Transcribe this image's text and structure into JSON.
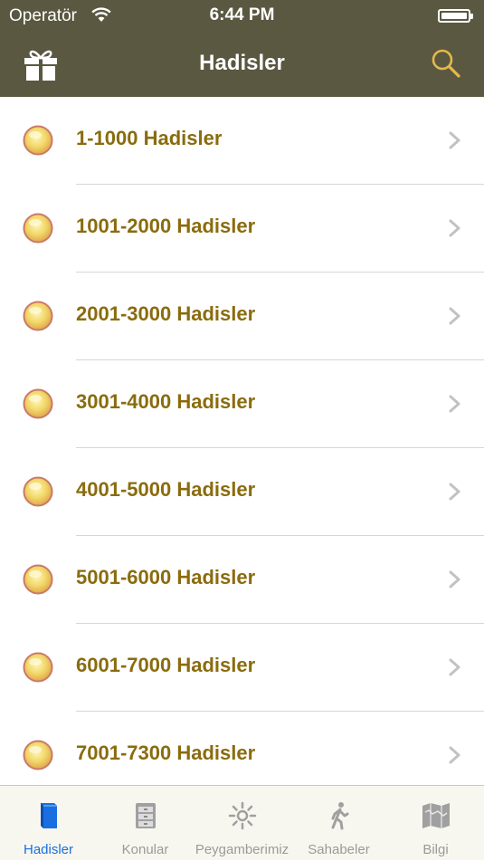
{
  "status_bar": {
    "carrier": "Operatör",
    "time": "6:44 PM"
  },
  "nav": {
    "title": "Hadisler",
    "left_icon": "gift-icon",
    "right_icon": "search-icon"
  },
  "list": {
    "items": [
      {
        "label": "1-1000 Hadisler"
      },
      {
        "label": "1001-2000 Hadisler"
      },
      {
        "label": "2001-3000 Hadisler"
      },
      {
        "label": "3001-4000 Hadisler"
      },
      {
        "label": "4001-5000 Hadisler"
      },
      {
        "label": "5001-6000 Hadisler"
      },
      {
        "label": "6001-7000 Hadisler"
      },
      {
        "label": "7001-7300 Hadisler"
      }
    ]
  },
  "tabbar": {
    "tabs": [
      {
        "label": "Hadisler",
        "icon": "book-icon",
        "active": true
      },
      {
        "label": "Konular",
        "icon": "cabinet-icon",
        "active": false
      },
      {
        "label": "Peygamberimiz",
        "icon": "sun-icon",
        "active": false
      },
      {
        "label": "Sahabeler",
        "icon": "walker-icon",
        "active": false
      },
      {
        "label": "Bilgi",
        "icon": "map-icon",
        "active": false
      }
    ]
  },
  "colors": {
    "header_bg": "#5a5840",
    "item_text": "#8a6c0e",
    "active_tab": "#1a6fe0",
    "search_accent": "#e6b84a"
  }
}
